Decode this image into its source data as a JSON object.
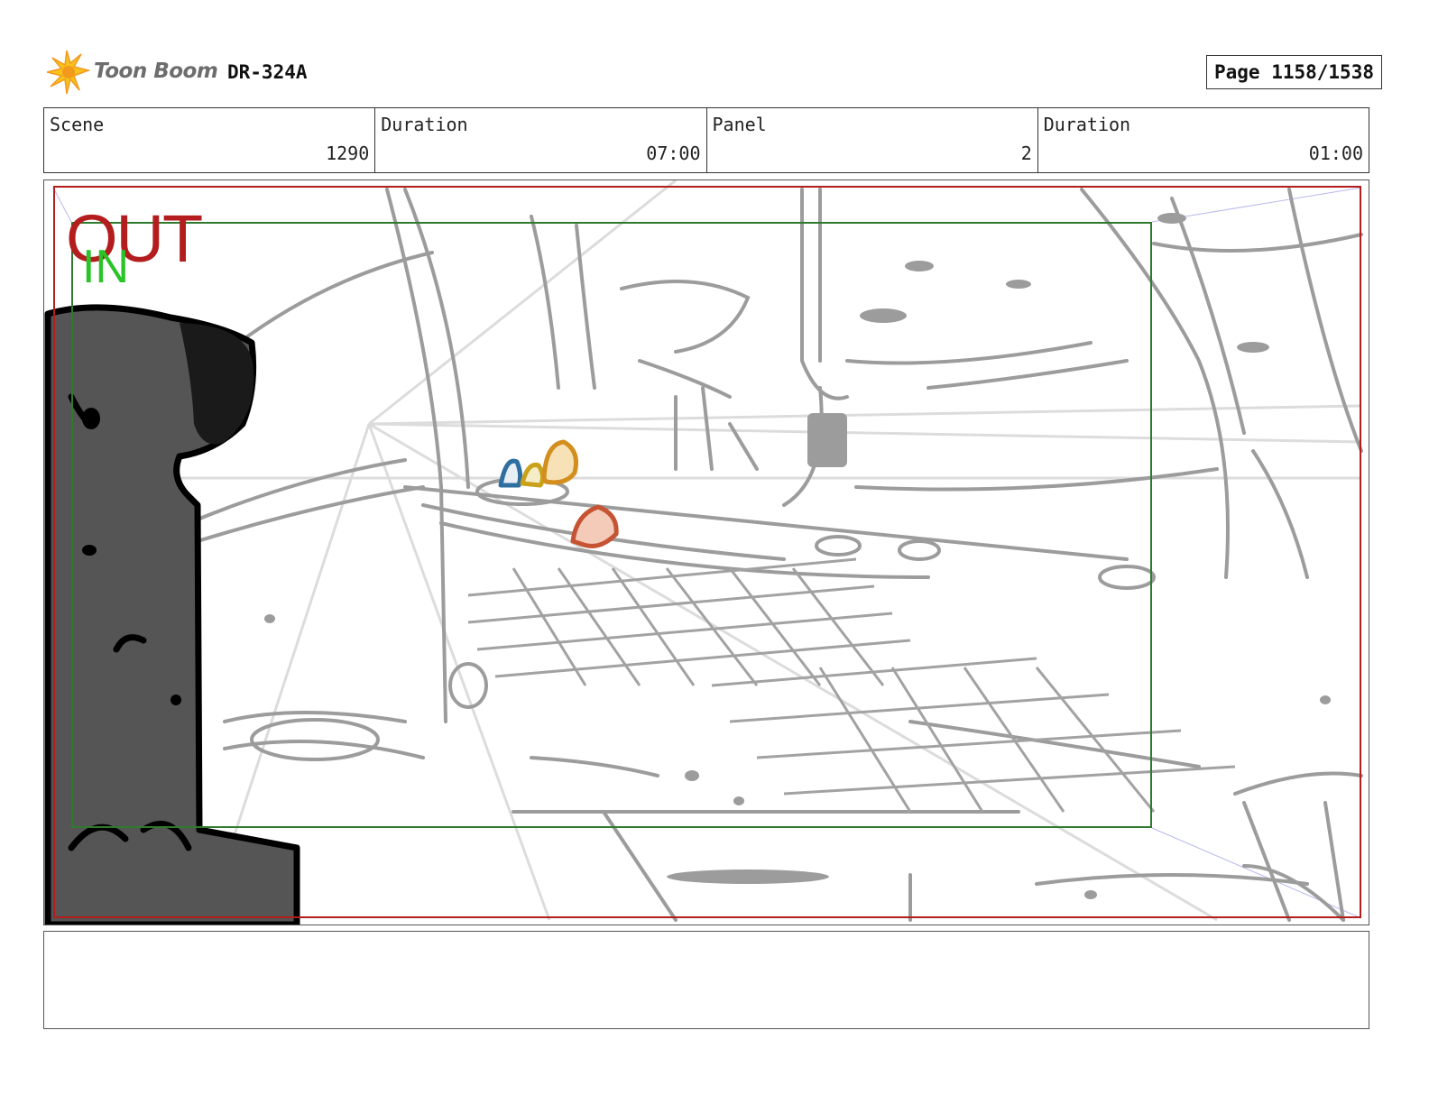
{
  "header": {
    "logo_text": "Toon Boom",
    "doc_id": "DR-324A",
    "page": "Page 1158/1538"
  },
  "info": {
    "scene_label": "Scene",
    "scene_value": "1290",
    "scene_duration_label": "Duration",
    "scene_duration_value": "07:00",
    "panel_label": "Panel",
    "panel_value": "2",
    "panel_duration_label": "Duration",
    "panel_duration_value": "01:00"
  },
  "panel": {
    "out_label": "OUT",
    "in_label": "IN",
    "out_color": "#b31d1d",
    "in_color": "#29c429"
  },
  "notes": {
    "text": ""
  }
}
